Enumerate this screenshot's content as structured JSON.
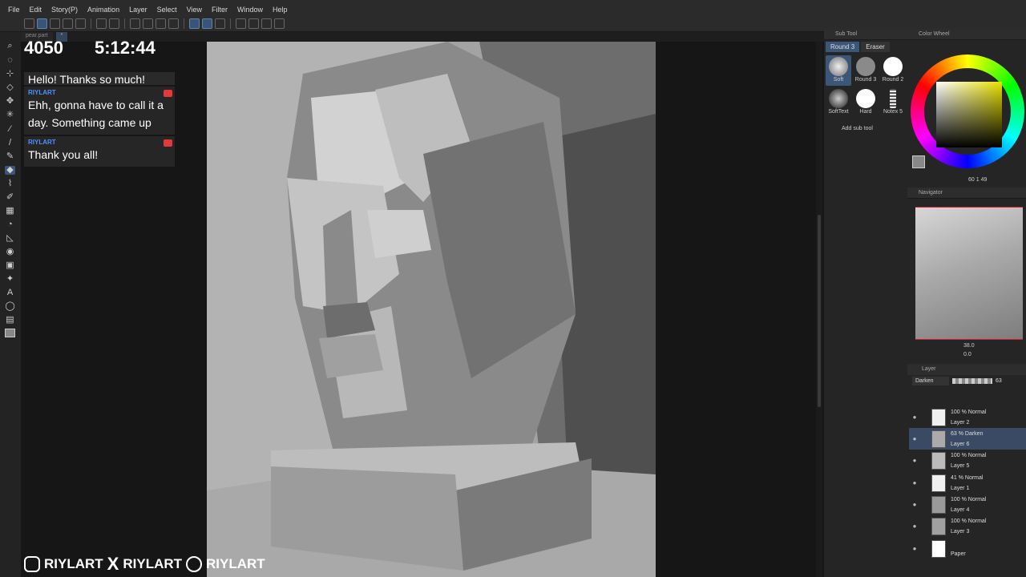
{
  "menu": [
    "File",
    "Edit",
    "Story(P)",
    "Animation",
    "Layer",
    "Select",
    "View",
    "Filter",
    "Window",
    "Help"
  ],
  "doc_tabs": [
    "pear.part",
    "*"
  ],
  "overlay": {
    "counter": "4050",
    "timer": "5:12:44",
    "chat_cut": "Hello! Thanks so much!",
    "messages": [
      {
        "user": "RIYLART",
        "text": "Ehh, gonna have to call it a day. Something came up"
      },
      {
        "user": "RIYLART",
        "text": "Thank you all!"
      }
    ],
    "socials": [
      "RIYLART",
      "RIYLART",
      "RIYLART"
    ]
  },
  "sub_tool": {
    "title": "Sub Tool",
    "tabs": [
      "Round 3",
      "Eraser"
    ],
    "brushes": [
      {
        "label": "Soft",
        "icon": "soft-brush-icon"
      },
      {
        "label": "Round 3",
        "icon": "round-brush-icon"
      },
      {
        "label": "Round 2",
        "icon": "round-brush-icon"
      },
      {
        "label": "SoftText",
        "icon": "soft-brush-icon"
      },
      {
        "label": "Hard",
        "icon": "hard-brush-icon"
      },
      {
        "label": "Notex 5",
        "icon": "texture-brush-icon"
      }
    ],
    "add_label": "Add sub tool"
  },
  "color_wheel": {
    "title": "Color Wheel",
    "values": "60  1  49"
  },
  "navigator": {
    "title": "Navigator",
    "zoom": "38.0",
    "rotation": "0.0"
  },
  "layer_panel": {
    "title": "Layer",
    "blend_mode": "Darken",
    "opacity": "63",
    "layers": [
      {
        "blend": "100 % Normal",
        "name": "Layer 2",
        "thumb": "#f0f0f0"
      },
      {
        "blend": "63 % Darken",
        "name": "Layer 6",
        "thumb": "#aaaaaa",
        "selected": true
      },
      {
        "blend": "100 % Normal",
        "name": "Layer 5",
        "thumb": "#bbbbbb"
      },
      {
        "blend": "41 % Normal",
        "name": "Layer 1",
        "thumb": "#f0f0f0"
      },
      {
        "blend": "100 % Normal",
        "name": "Layer 4",
        "thumb": "#9a9a9a"
      },
      {
        "blend": "100 % Normal",
        "name": "Layer 3",
        "thumb": "#a0a0a0"
      },
      {
        "blend": "",
        "name": "Paper",
        "thumb": "#ffffff"
      }
    ]
  }
}
